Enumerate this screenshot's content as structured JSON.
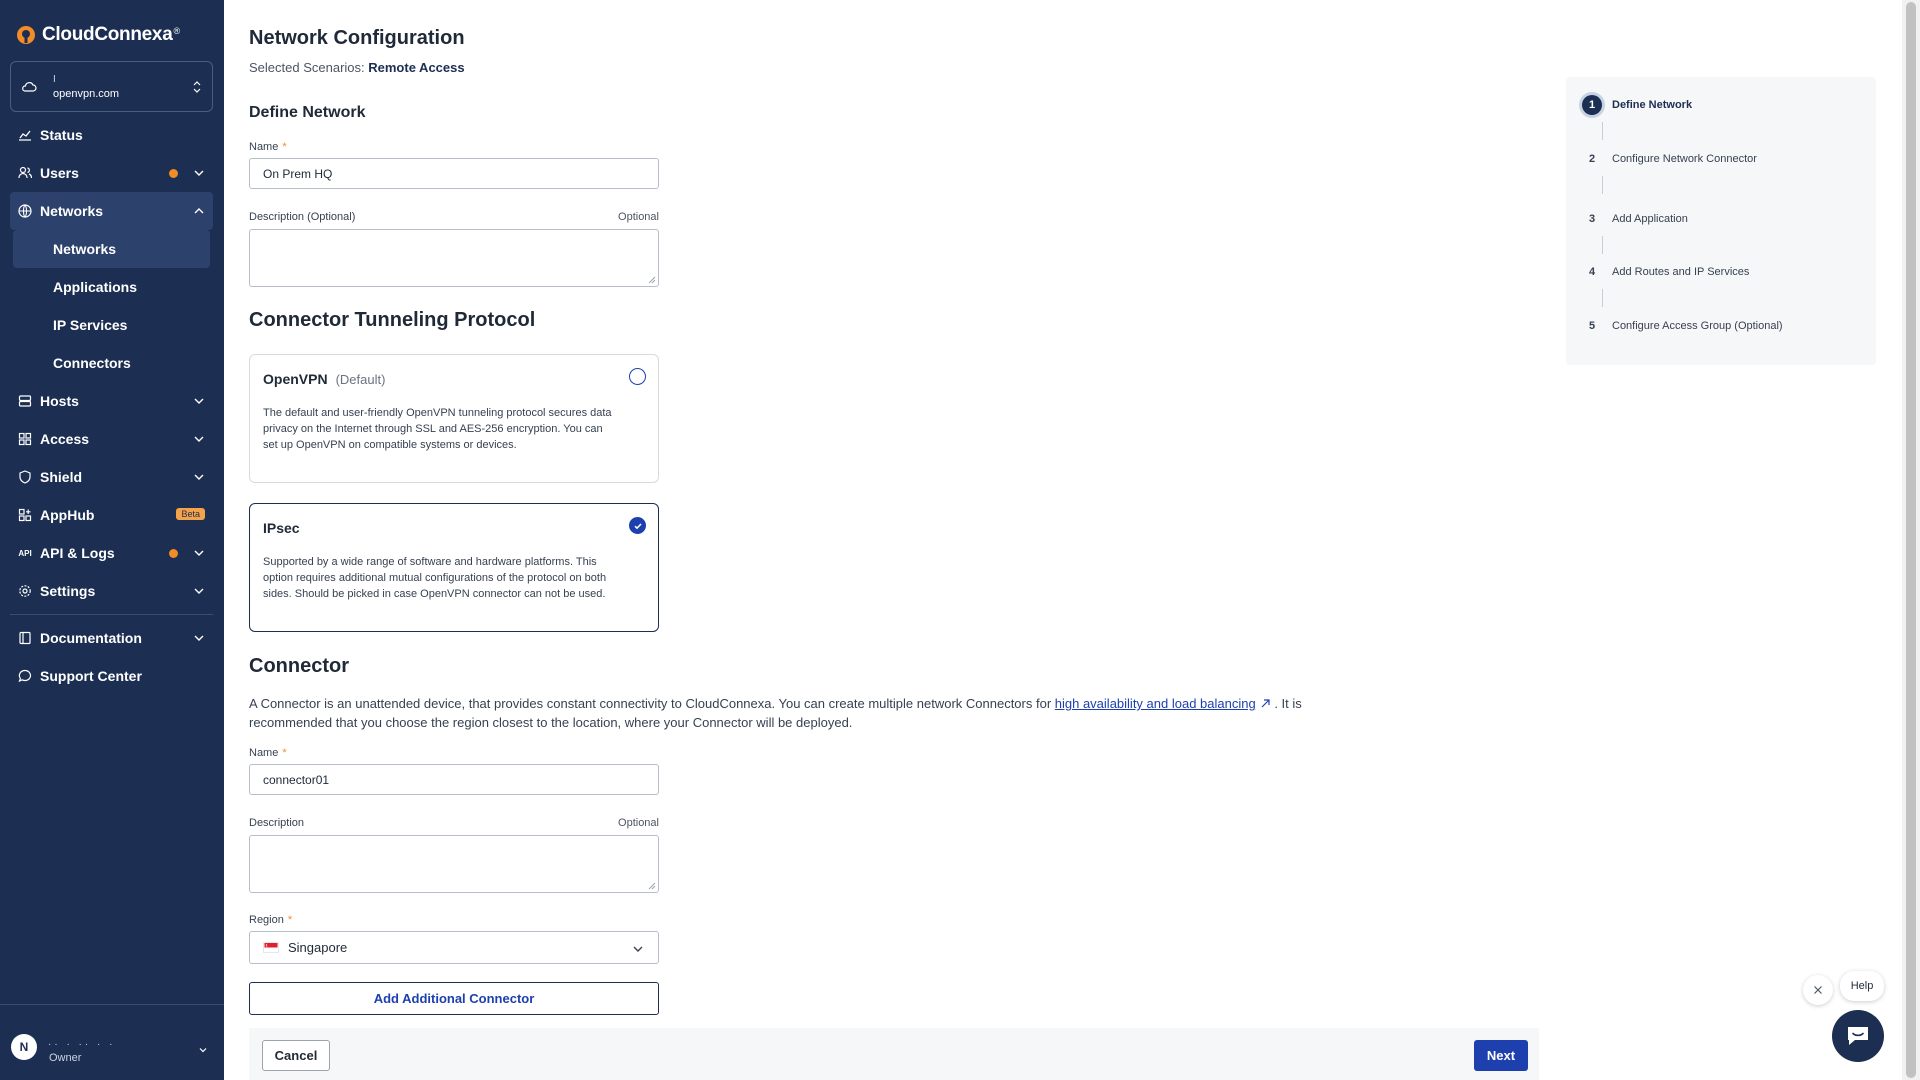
{
  "app": {
    "brand": "CloudConnexa",
    "trademark": "®"
  },
  "org": {
    "line1": "I",
    "domain": "openvpn.com"
  },
  "nav": {
    "status": "Status",
    "users": "Users",
    "networks": "Networks",
    "networks_sub": [
      "Networks",
      "Applications",
      "IP Services",
      "Connectors"
    ],
    "hosts": "Hosts",
    "access": "Access",
    "shield": "Shield",
    "apphub": "AppHub",
    "apphub_badge": "Beta",
    "api_logs": "API & Logs",
    "api_icon_text": "API",
    "settings": "Settings",
    "documentation": "Documentation",
    "support": "Support Center"
  },
  "user": {
    "initial": "N",
    "name": "·· ·  ·· ·  ·",
    "role": "Owner"
  },
  "page": {
    "title": "Network Configuration",
    "scenario_label": "Selected Scenarios:",
    "scenario_value": "Remote Access"
  },
  "define_network": {
    "heading": "Define Network",
    "name_label": "Name",
    "required_mark": "*",
    "name_value": "On Prem HQ",
    "desc_label": "Description (Optional)",
    "optional": "Optional"
  },
  "protocol": {
    "heading": "Connector Tunneling Protocol",
    "options": [
      {
        "title": "OpenVPN",
        "subtitle": "(Default)",
        "description": "The default and user-friendly OpenVPN tunneling protocol secures data privacy on the Internet through SSL and AES-256 encryption. You can set up OpenVPN on compatible systems or devices.",
        "selected": false
      },
      {
        "title": "IPsec",
        "subtitle": "",
        "description": "Supported by a wide range of software and hardware platforms. This option requires additional mutual configurations of the protocol on both sides. Should be picked in case OpenVPN connector can not be used.",
        "selected": true
      }
    ]
  },
  "connector": {
    "heading": "Connector",
    "desc_before": "A Connector is an unattended device, that provides constant connectivity to CloudConnexa. You can create multiple network Connectors for ",
    "desc_link": "high availability and load balancing",
    "desc_after": " . It is recommended that you choose the region closest to the location, where your Connector will be deployed.",
    "name_label": "Name",
    "name_value": "connector01",
    "desc_label": "Description",
    "optional": "Optional",
    "region_label": "Region",
    "region_value": "Singapore",
    "add_button": "Add Additional Connector"
  },
  "footer": {
    "cancel": "Cancel",
    "next": "Next"
  },
  "steps": [
    {
      "num": "1",
      "label": "Define Network",
      "active": true
    },
    {
      "num": "2",
      "label": "Configure Network Connector",
      "active": false
    },
    {
      "num": "3",
      "label": "Add Application",
      "active": false
    },
    {
      "num": "4",
      "label": "Add Routes and IP Services",
      "active": false
    },
    {
      "num": "5",
      "label": "Configure Access Group (Optional)",
      "active": false
    }
  ],
  "help": {
    "label": "Help"
  },
  "colors": {
    "sidebar": "#1c2e52",
    "primary": "#1e40af",
    "accent": "#f28c28"
  }
}
